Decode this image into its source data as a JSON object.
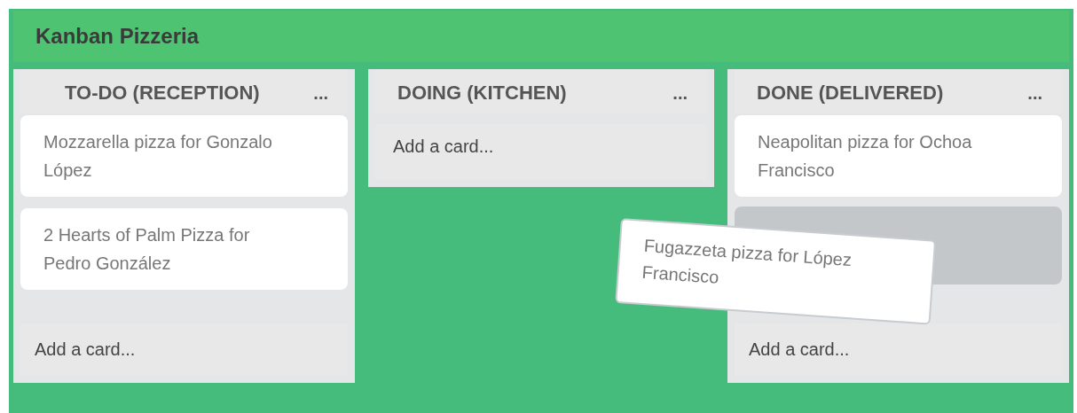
{
  "board": {
    "title": "Kanban Pizzeria"
  },
  "lists": [
    {
      "title": "TO-DO (RECEPTION)",
      "menu": "...",
      "cards": [
        {
          "kind": "card",
          "text": "Mozzarella pizza for Gonzalo López"
        },
        {
          "kind": "card",
          "text": "2 Hearts of Palm Pizza for Pedro González"
        }
      ],
      "add_label": "Add a card..."
    },
    {
      "title": "DOING (KITCHEN)",
      "menu": "...",
      "add_label": "Add a card..."
    },
    {
      "title": "DONE (DELIVERED)",
      "menu": "...",
      "cards": [
        {
          "kind": "card",
          "text": "Neapolitan pizza for Ochoa Francisco"
        },
        {
          "kind": "drop-slot"
        }
      ],
      "add_label": "Add a card..."
    }
  ],
  "dragging_card": {
    "text": "Fugazzeta pizza for López Francisco"
  }
}
